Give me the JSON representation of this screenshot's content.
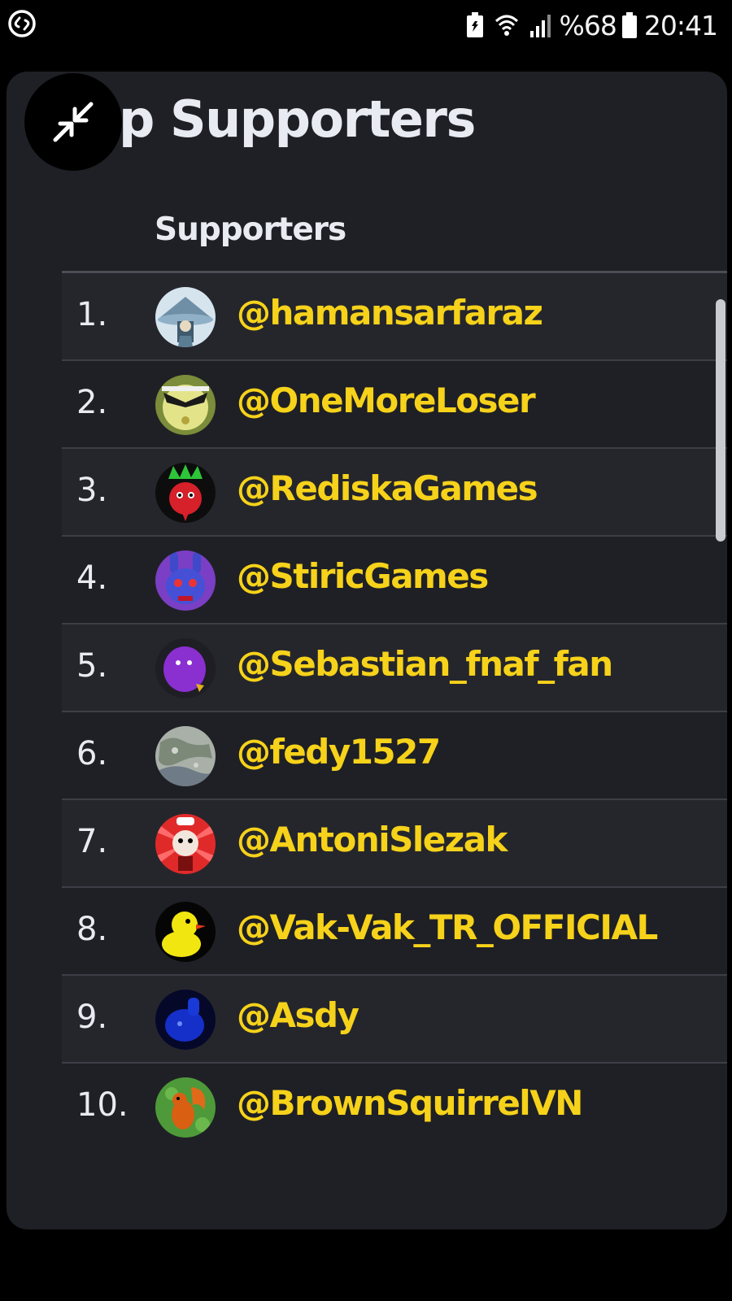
{
  "status_bar": {
    "battery_text": "%68",
    "time": "20:41",
    "icons": [
      "shazam-icon",
      "battery-saver-icon",
      "wifi-icon",
      "signal-icon",
      "battery-icon"
    ]
  },
  "card": {
    "title": "p Supporters",
    "column_header": "Supporters",
    "collapse_icon": "collapse-arrows-icon"
  },
  "supporters": [
    {
      "rank": "1.",
      "handle": "@hamansarfaraz",
      "avatar": "wizard-avatar"
    },
    {
      "rank": "2.",
      "handle": "@OneMoreLoser",
      "avatar": "mask-avatar"
    },
    {
      "rank": "3.",
      "handle": "@RediskaGames",
      "avatar": "radish-avatar"
    },
    {
      "rank": "4.",
      "handle": "@StiricGames",
      "avatar": "bunny-avatar"
    },
    {
      "rank": "5.",
      "handle": "@Sebastian_fnaf_fan",
      "avatar": "purple-blob-avatar"
    },
    {
      "rank": "6.",
      "handle": "@fedy1527",
      "avatar": "map-avatar"
    },
    {
      "rank": "7.",
      "handle": "@AntoniSlezak",
      "avatar": "chef-avatar"
    },
    {
      "rank": "8.",
      "handle": "@Vak-Vak_TR_OFFICIAL",
      "avatar": "duck-avatar"
    },
    {
      "rank": "9.",
      "handle": "@Asdy",
      "avatar": "blue-blob-avatar"
    },
    {
      "rank": "10.",
      "handle": "@BrownSquirrelVN",
      "avatar": "squirrel-avatar"
    }
  ],
  "colors": {
    "handle": "#f6d21a",
    "card_bg": "#1f2025",
    "text": "#e9ebf2"
  }
}
